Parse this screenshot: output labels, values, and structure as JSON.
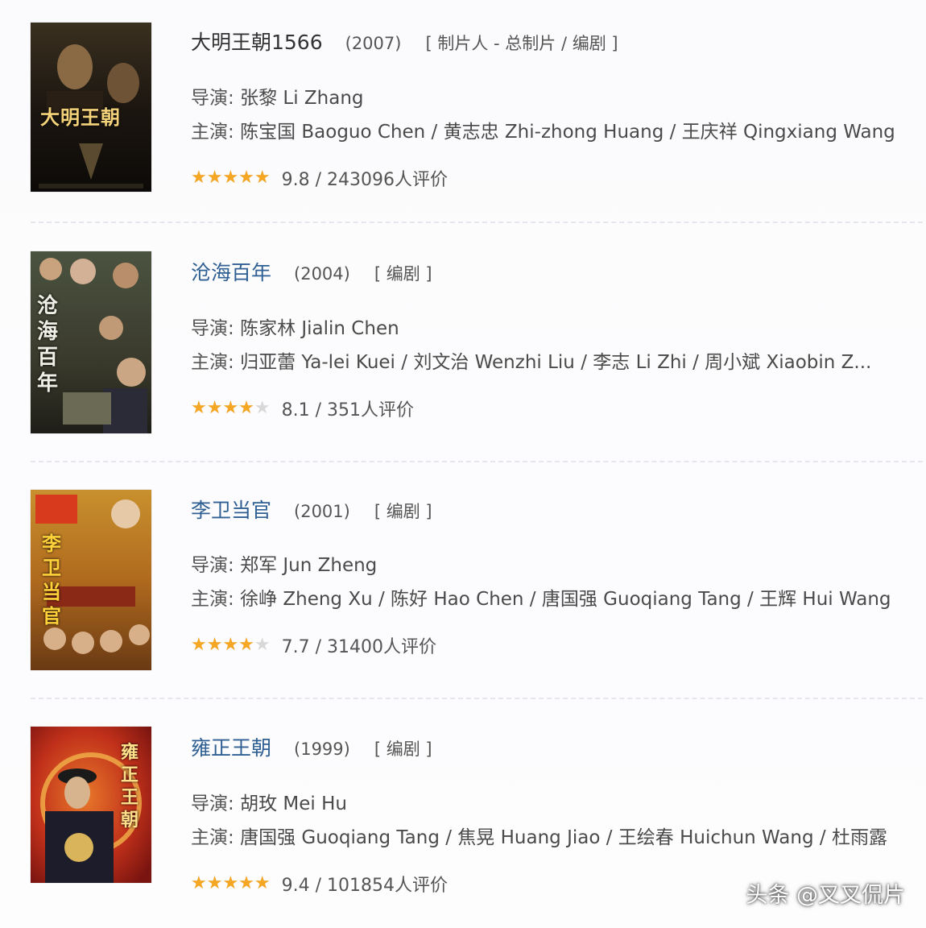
{
  "items": [
    {
      "title": "大明王朝1566",
      "year": "(2007)",
      "role": "[ 制片人 - 总制片 / 编剧 ]",
      "director_label": "导演:",
      "director": "张黎 Li Zhang",
      "cast_label": "主演:",
      "cast": "陈宝国 Baoguo Chen / 黄志忠 Zhi-zhong Huang / 王庆祥 Qingxiang Wang",
      "rating_text": "9.8 / 243096人评价",
      "rating_fraction": 1.0,
      "poster_text": "大明王朝"
    },
    {
      "title": "沧海百年",
      "year": "(2004)",
      "role": "[ 编剧 ]",
      "director_label": "导演:",
      "director": "陈家林 Jialin Chen",
      "cast_label": "主演:",
      "cast": "归亚蕾 Ya-lei Kuei / 刘文治 Wenzhi Liu / 李志 Li Zhi / 周小斌 Xiaobin Z...",
      "rating_text": "8.1 / 351人评价",
      "rating_fraction": 0.8,
      "poster_text": "沧海百年"
    },
    {
      "title": "李卫当官",
      "year": "(2001)",
      "role": "[ 编剧 ]",
      "director_label": "导演:",
      "director": "郑军 Jun Zheng",
      "cast_label": "主演:",
      "cast": "徐峥 Zheng Xu / 陈好 Hao Chen / 唐国强 Guoqiang Tang / 王辉 Hui Wang",
      "rating_text": "7.7 / 31400人评价",
      "rating_fraction": 0.8,
      "poster_text": "李卫当官"
    },
    {
      "title": "雍正王朝",
      "year": "(1999)",
      "role": "[ 编剧 ]",
      "director_label": "导演:",
      "director": "胡玫 Mei Hu",
      "cast_label": "主演:",
      "cast": "唐国强 Guoqiang Tang / 焦晃 Huang Jiao / 王绘春 Huichun Wang / 杜雨露",
      "rating_text": "9.4 / 101854人评价",
      "rating_fraction": 1.0,
      "poster_text": "雍正王朝"
    }
  ],
  "star_glyphs": "★★★★★",
  "watermark": "头条 @叉叉侃片",
  "colors": {
    "title_link": "#2f5f93",
    "star": "#f5a623",
    "star_empty": "#d8d8d8"
  }
}
